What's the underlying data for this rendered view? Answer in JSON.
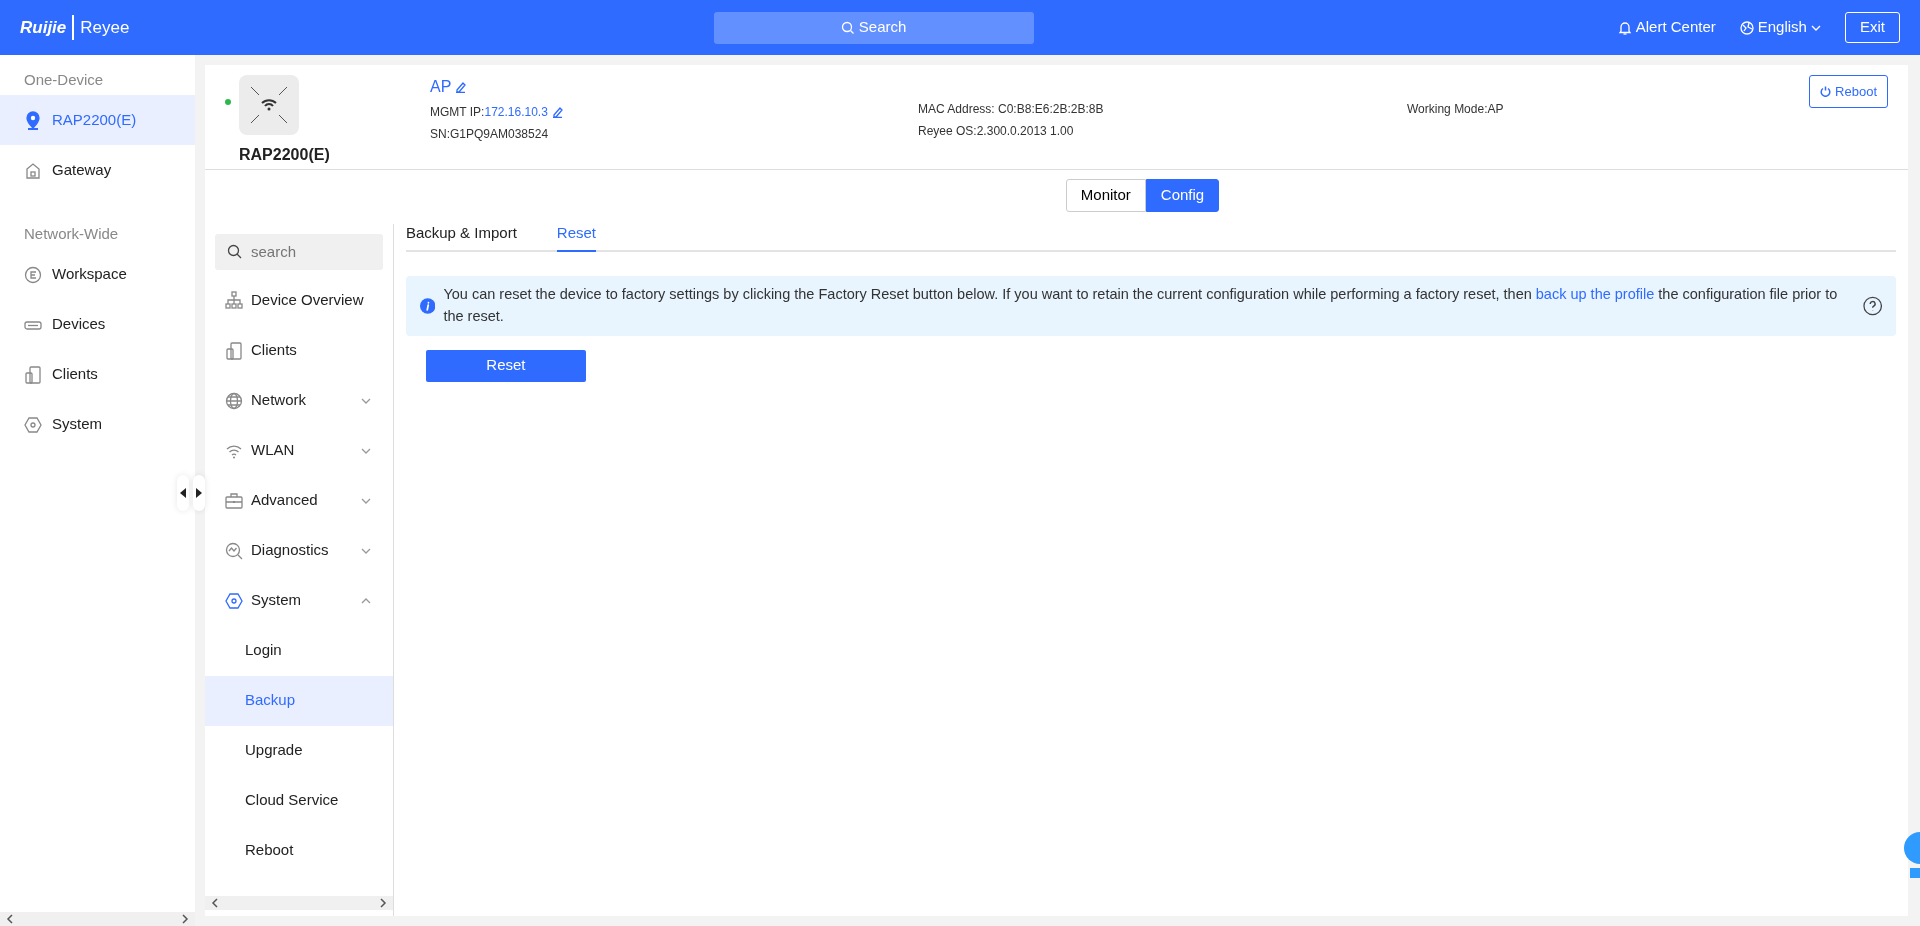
{
  "header": {
    "logo": {
      "brand": "Ruijie",
      "product": "Reyee"
    },
    "search": "Search",
    "alert_center": "Alert Center",
    "language": "English",
    "exit": "Exit"
  },
  "sidebar": {
    "sections": [
      {
        "heading": "One-Device",
        "items": [
          {
            "label": "RAP2200(E)",
            "selected": true
          },
          {
            "label": "Gateway",
            "selected": false
          }
        ]
      },
      {
        "heading": "Network-Wide",
        "items": [
          {
            "label": "Workspace",
            "selected": false
          },
          {
            "label": "Devices",
            "selected": false
          },
          {
            "label": "Clients",
            "selected": false
          },
          {
            "label": "System",
            "selected": false
          }
        ]
      }
    ]
  },
  "device": {
    "online": true,
    "model": "RAP2200(E)",
    "name": "AP",
    "mgmt_ip_label": "MGMT IP:",
    "mgmt_ip": "172.16.10.3",
    "sn": "SN:G1PQ9AM038524",
    "mac": "MAC Address: C0:B8:E6:2B:2B:8B",
    "os": "Reyee OS:2.300.0.2013 1.00",
    "mode": "Working Mode:AP",
    "reboot": "Reboot"
  },
  "view_tabs": [
    {
      "label": "Monitor",
      "selected": false
    },
    {
      "label": "Config",
      "selected": true
    }
  ],
  "menu": {
    "search": {
      "placeholder": "search"
    },
    "items": [
      {
        "label": "Device Overview"
      },
      {
        "label": "Clients"
      },
      {
        "label": "Network",
        "expanded": false
      },
      {
        "label": "WLAN",
        "expanded": false
      },
      {
        "label": "Advanced",
        "expanded": false
      },
      {
        "label": "Diagnostics",
        "expanded": false
      },
      {
        "label": "System",
        "expanded": true,
        "children": [
          {
            "label": "Login",
            "selected": false
          },
          {
            "label": "Backup",
            "selected": true
          },
          {
            "label": "Upgrade",
            "selected": false
          },
          {
            "label": "Cloud Service",
            "selected": false
          },
          {
            "label": "Reboot",
            "selected": false
          }
        ]
      }
    ]
  },
  "content": {
    "tabs": [
      {
        "label": "Backup & Import",
        "selected": false
      },
      {
        "label": "Reset",
        "selected": true
      }
    ],
    "notice": {
      "text_before": "You can reset the device to factory settings by clicking the Factory Reset button below. If you want to retain the current configuration while performing a factory reset, then",
      "link": "back up the profile",
      "text_after": "the configuration file prior to the reset."
    },
    "reset_button": "Reset"
  }
}
